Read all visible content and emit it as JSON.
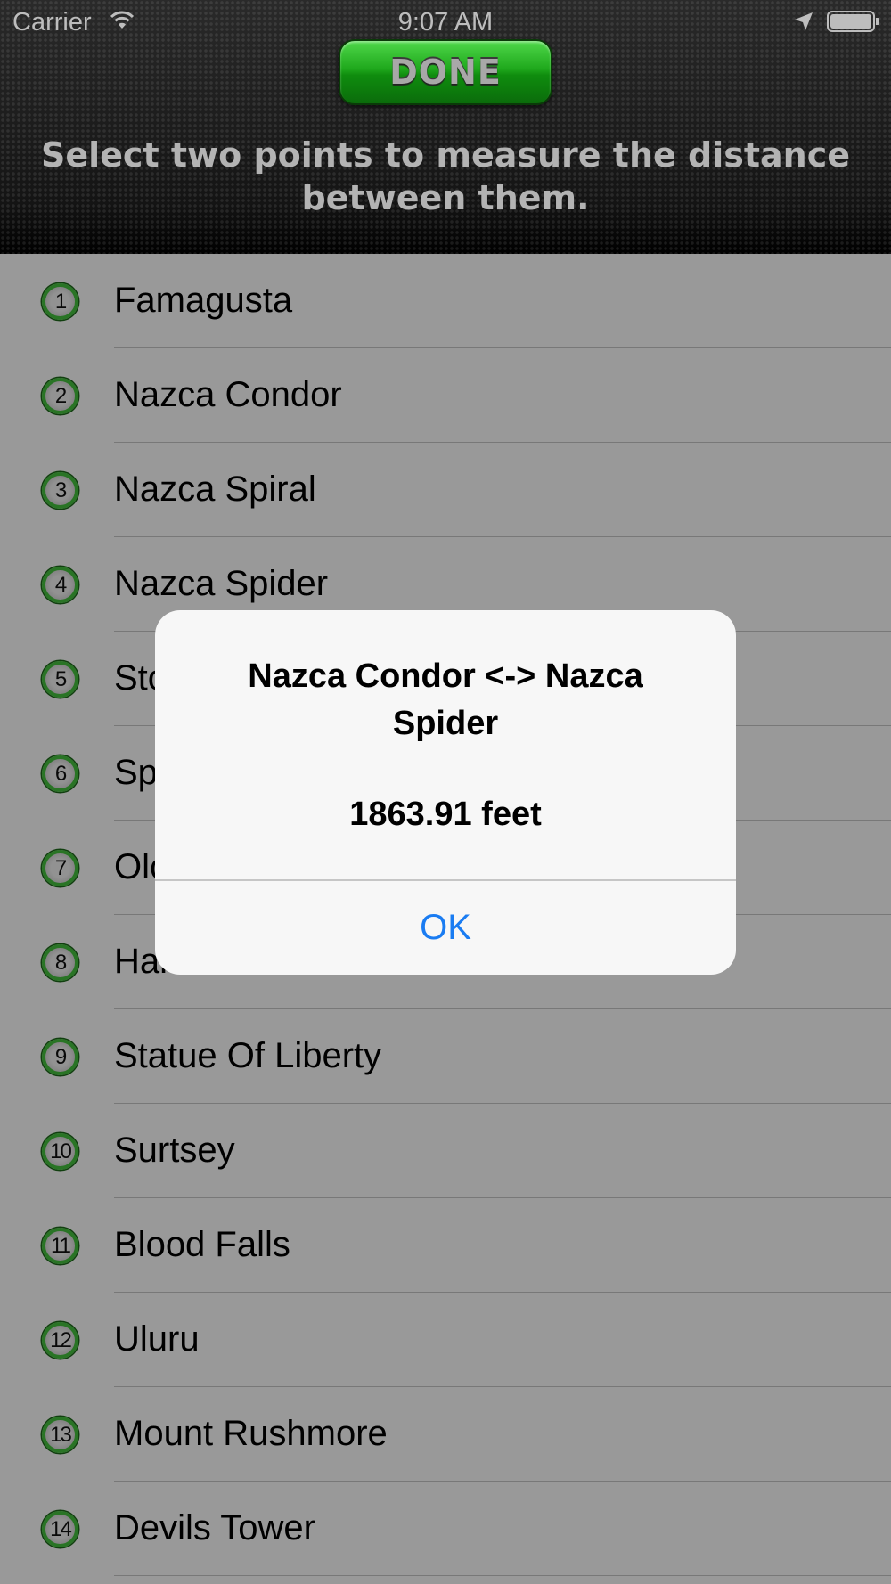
{
  "status_bar": {
    "carrier": "Carrier",
    "time": "9:07 AM",
    "icons": [
      "wifi-icon",
      "location-arrow-icon",
      "battery-icon"
    ]
  },
  "header": {
    "done_label": "DONE",
    "instructions": "Select two points to measure the distance between them."
  },
  "list": {
    "items": [
      {
        "number": "1",
        "label": "Famagusta"
      },
      {
        "number": "2",
        "label": "Nazca Condor"
      },
      {
        "number": "3",
        "label": "Nazca Spiral"
      },
      {
        "number": "4",
        "label": "Nazca Spider"
      },
      {
        "number": "5",
        "label": "Sto"
      },
      {
        "number": "6",
        "label": "Sp"
      },
      {
        "number": "7",
        "label": "Olc"
      },
      {
        "number": "8",
        "label": "Hal"
      },
      {
        "number": "9",
        "label": "Statue Of Liberty"
      },
      {
        "number": "10",
        "label": "Surtsey"
      },
      {
        "number": "11",
        "label": "Blood Falls"
      },
      {
        "number": "12",
        "label": "Uluru"
      },
      {
        "number": "13",
        "label": "Mount Rushmore"
      },
      {
        "number": "14",
        "label": "Devils Tower"
      }
    ]
  },
  "alert": {
    "title": "Nazca Condor <-> Nazca Spider",
    "message": "1863.91 feet",
    "ok_label": "OK"
  },
  "colors": {
    "done_button": "#1fa81c",
    "badge_ring": "#45c23e",
    "alert_action": "#1a7cf2"
  }
}
